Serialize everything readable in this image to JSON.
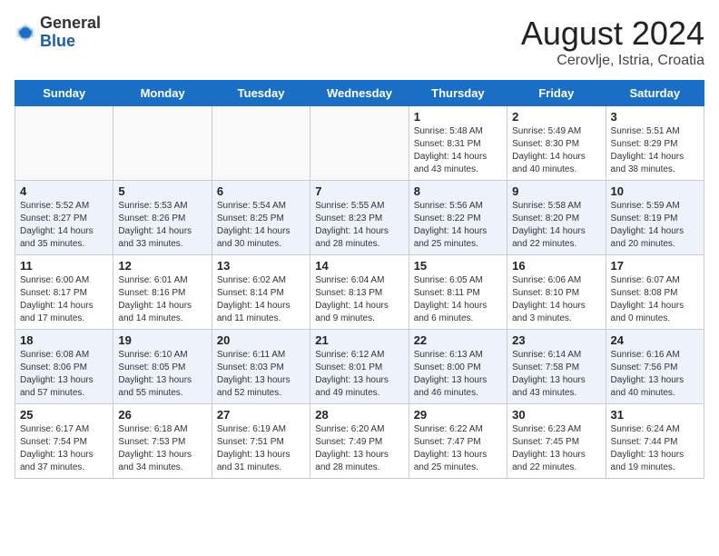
{
  "header": {
    "logo_general": "General",
    "logo_blue": "Blue",
    "month_title": "August 2024",
    "location": "Cerovlje, Istria, Croatia"
  },
  "weekdays": [
    "Sunday",
    "Monday",
    "Tuesday",
    "Wednesday",
    "Thursday",
    "Friday",
    "Saturday"
  ],
  "weeks": [
    [
      {
        "day": "",
        "info": ""
      },
      {
        "day": "",
        "info": ""
      },
      {
        "day": "",
        "info": ""
      },
      {
        "day": "",
        "info": ""
      },
      {
        "day": "1",
        "info": "Sunrise: 5:48 AM\nSunset: 8:31 PM\nDaylight: 14 hours\nand 43 minutes."
      },
      {
        "day": "2",
        "info": "Sunrise: 5:49 AM\nSunset: 8:30 PM\nDaylight: 14 hours\nand 40 minutes."
      },
      {
        "day": "3",
        "info": "Sunrise: 5:51 AM\nSunset: 8:29 PM\nDaylight: 14 hours\nand 38 minutes."
      }
    ],
    [
      {
        "day": "4",
        "info": "Sunrise: 5:52 AM\nSunset: 8:27 PM\nDaylight: 14 hours\nand 35 minutes."
      },
      {
        "day": "5",
        "info": "Sunrise: 5:53 AM\nSunset: 8:26 PM\nDaylight: 14 hours\nand 33 minutes."
      },
      {
        "day": "6",
        "info": "Sunrise: 5:54 AM\nSunset: 8:25 PM\nDaylight: 14 hours\nand 30 minutes."
      },
      {
        "day": "7",
        "info": "Sunrise: 5:55 AM\nSunset: 8:23 PM\nDaylight: 14 hours\nand 28 minutes."
      },
      {
        "day": "8",
        "info": "Sunrise: 5:56 AM\nSunset: 8:22 PM\nDaylight: 14 hours\nand 25 minutes."
      },
      {
        "day": "9",
        "info": "Sunrise: 5:58 AM\nSunset: 8:20 PM\nDaylight: 14 hours\nand 22 minutes."
      },
      {
        "day": "10",
        "info": "Sunrise: 5:59 AM\nSunset: 8:19 PM\nDaylight: 14 hours\nand 20 minutes."
      }
    ],
    [
      {
        "day": "11",
        "info": "Sunrise: 6:00 AM\nSunset: 8:17 PM\nDaylight: 14 hours\nand 17 minutes."
      },
      {
        "day": "12",
        "info": "Sunrise: 6:01 AM\nSunset: 8:16 PM\nDaylight: 14 hours\nand 14 minutes."
      },
      {
        "day": "13",
        "info": "Sunrise: 6:02 AM\nSunset: 8:14 PM\nDaylight: 14 hours\nand 11 minutes."
      },
      {
        "day": "14",
        "info": "Sunrise: 6:04 AM\nSunset: 8:13 PM\nDaylight: 14 hours\nand 9 minutes."
      },
      {
        "day": "15",
        "info": "Sunrise: 6:05 AM\nSunset: 8:11 PM\nDaylight: 14 hours\nand 6 minutes."
      },
      {
        "day": "16",
        "info": "Sunrise: 6:06 AM\nSunset: 8:10 PM\nDaylight: 14 hours\nand 3 minutes."
      },
      {
        "day": "17",
        "info": "Sunrise: 6:07 AM\nSunset: 8:08 PM\nDaylight: 14 hours\nand 0 minutes."
      }
    ],
    [
      {
        "day": "18",
        "info": "Sunrise: 6:08 AM\nSunset: 8:06 PM\nDaylight: 13 hours\nand 57 minutes."
      },
      {
        "day": "19",
        "info": "Sunrise: 6:10 AM\nSunset: 8:05 PM\nDaylight: 13 hours\nand 55 minutes."
      },
      {
        "day": "20",
        "info": "Sunrise: 6:11 AM\nSunset: 8:03 PM\nDaylight: 13 hours\nand 52 minutes."
      },
      {
        "day": "21",
        "info": "Sunrise: 6:12 AM\nSunset: 8:01 PM\nDaylight: 13 hours\nand 49 minutes."
      },
      {
        "day": "22",
        "info": "Sunrise: 6:13 AM\nSunset: 8:00 PM\nDaylight: 13 hours\nand 46 minutes."
      },
      {
        "day": "23",
        "info": "Sunrise: 6:14 AM\nSunset: 7:58 PM\nDaylight: 13 hours\nand 43 minutes."
      },
      {
        "day": "24",
        "info": "Sunrise: 6:16 AM\nSunset: 7:56 PM\nDaylight: 13 hours\nand 40 minutes."
      }
    ],
    [
      {
        "day": "25",
        "info": "Sunrise: 6:17 AM\nSunset: 7:54 PM\nDaylight: 13 hours\nand 37 minutes."
      },
      {
        "day": "26",
        "info": "Sunrise: 6:18 AM\nSunset: 7:53 PM\nDaylight: 13 hours\nand 34 minutes."
      },
      {
        "day": "27",
        "info": "Sunrise: 6:19 AM\nSunset: 7:51 PM\nDaylight: 13 hours\nand 31 minutes."
      },
      {
        "day": "28",
        "info": "Sunrise: 6:20 AM\nSunset: 7:49 PM\nDaylight: 13 hours\nand 28 minutes."
      },
      {
        "day": "29",
        "info": "Sunrise: 6:22 AM\nSunset: 7:47 PM\nDaylight: 13 hours\nand 25 minutes."
      },
      {
        "day": "30",
        "info": "Sunrise: 6:23 AM\nSunset: 7:45 PM\nDaylight: 13 hours\nand 22 minutes."
      },
      {
        "day": "31",
        "info": "Sunrise: 6:24 AM\nSunset: 7:44 PM\nDaylight: 13 hours\nand 19 minutes."
      }
    ]
  ]
}
